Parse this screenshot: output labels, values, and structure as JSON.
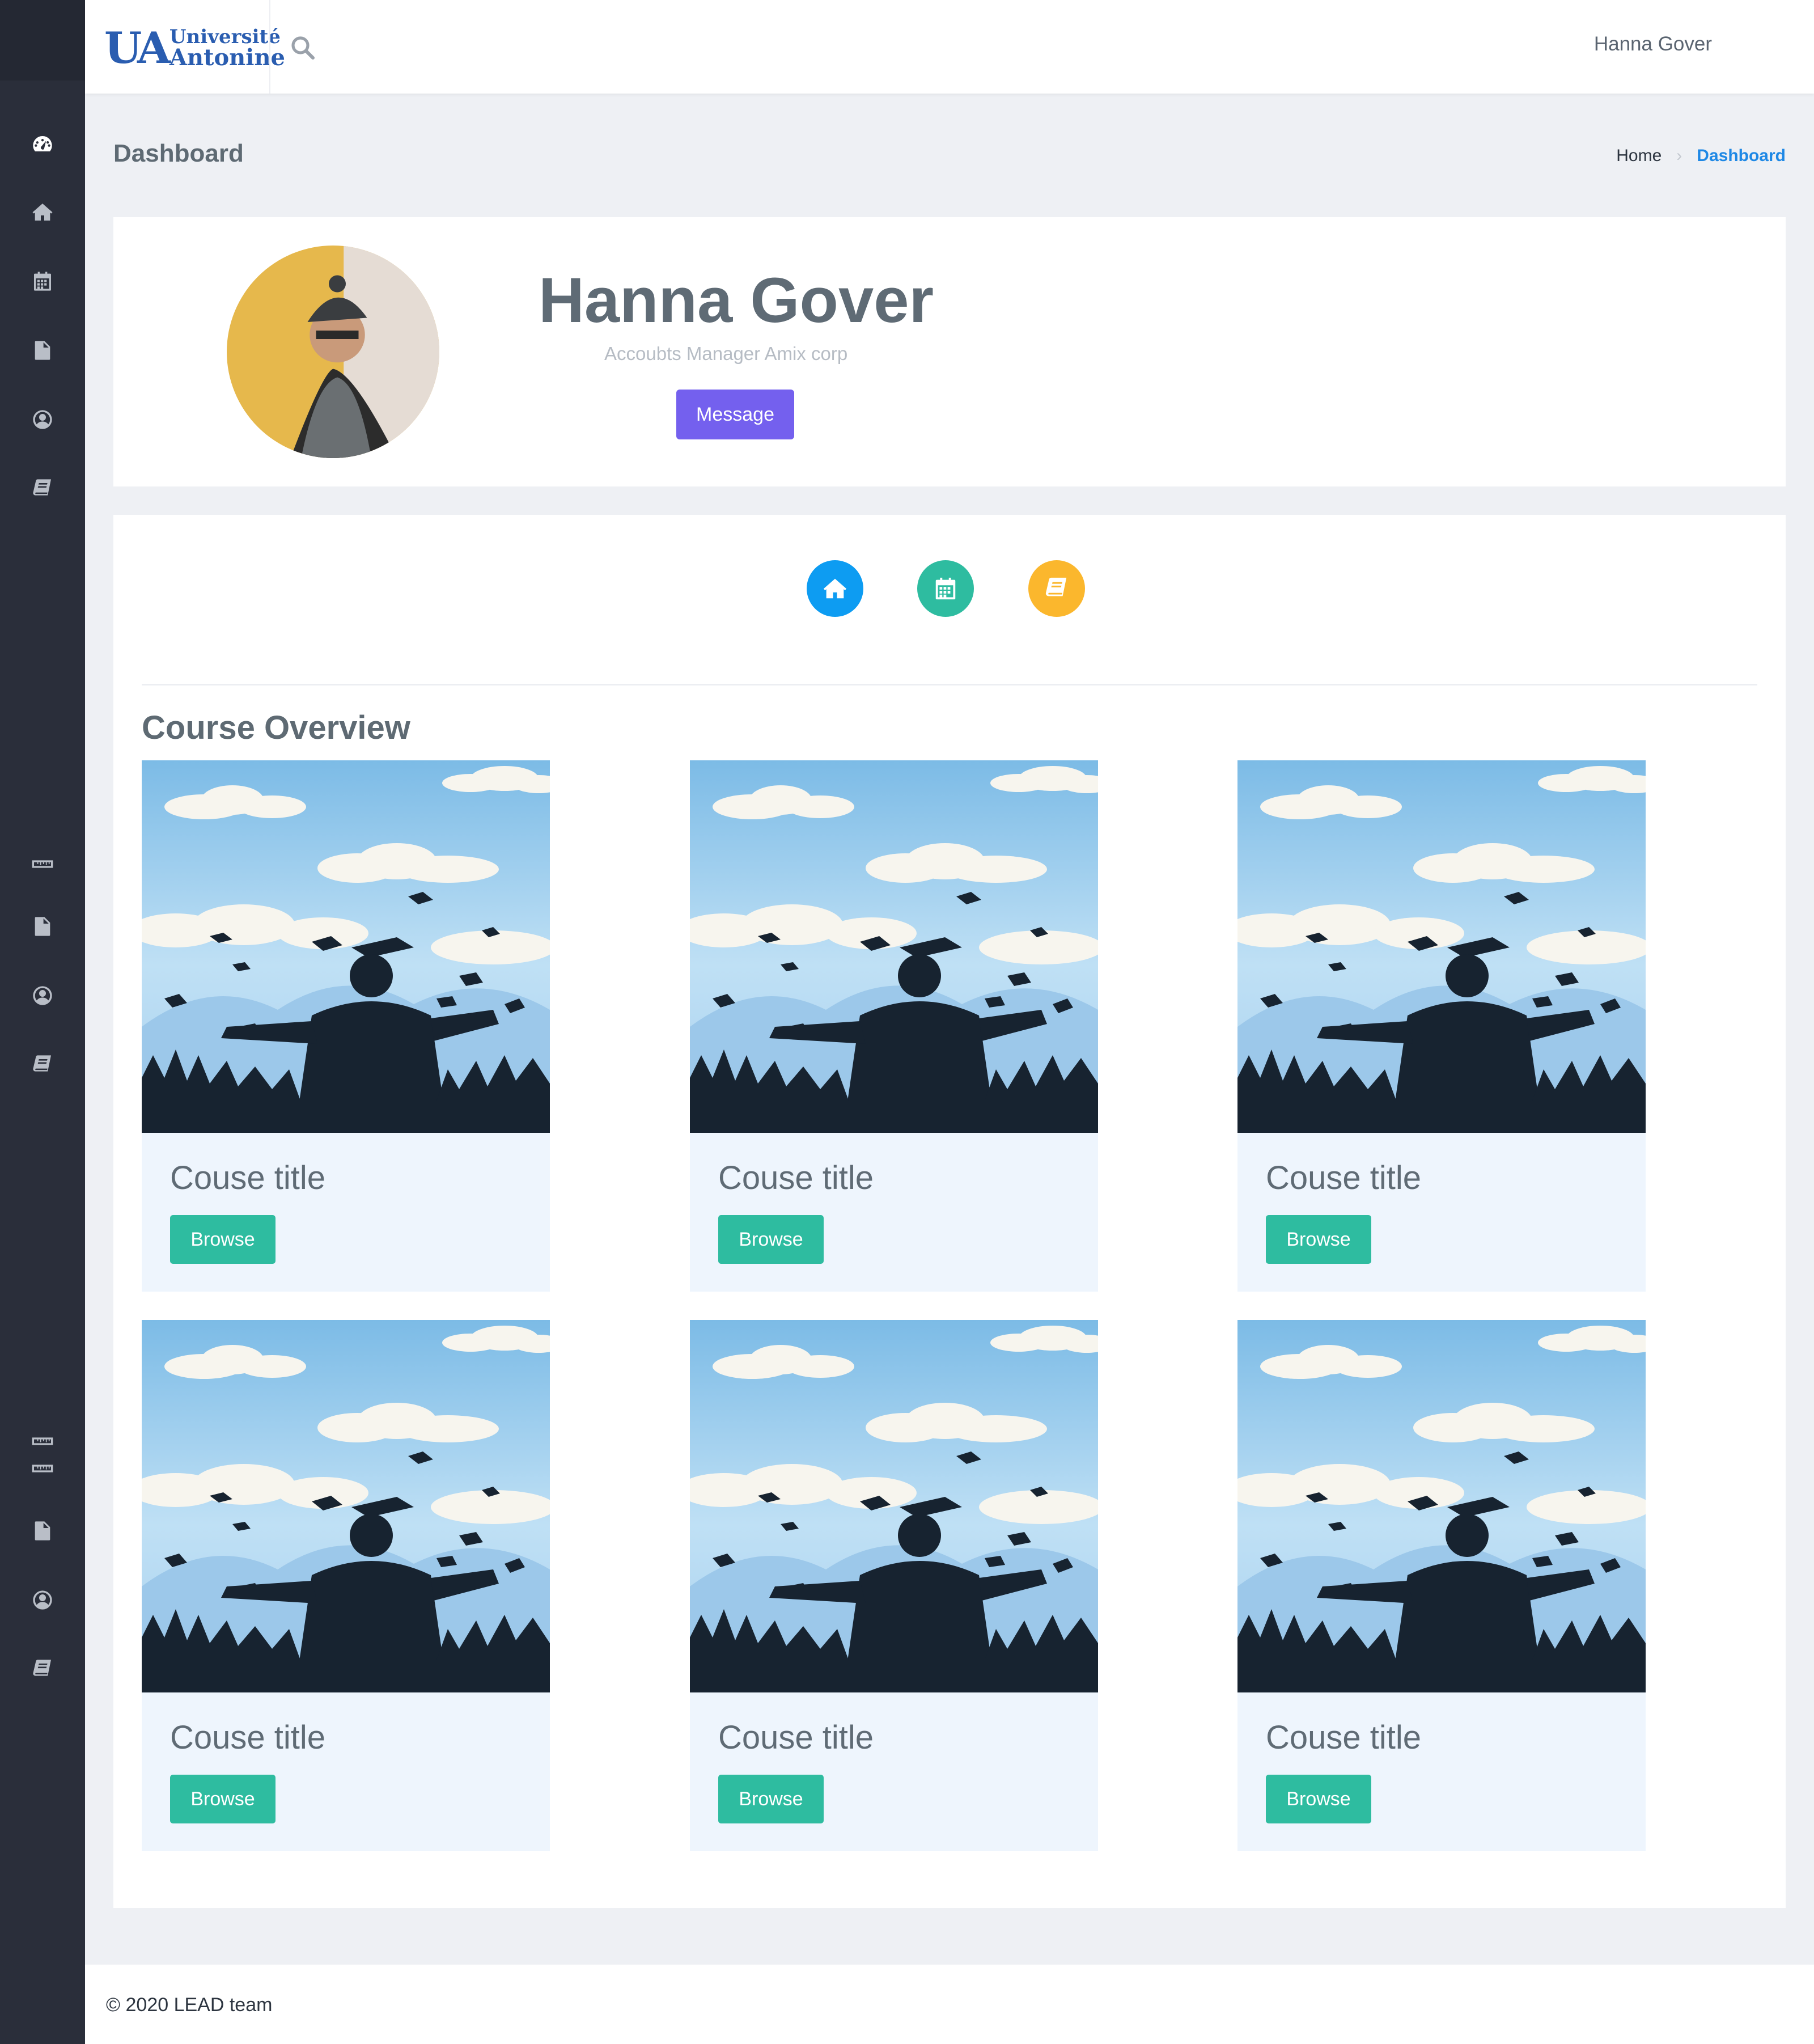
{
  "brand": {
    "logo_line1": "Université",
    "logo_line2": "Antonine",
    "logo_mark": "UA"
  },
  "header": {
    "username": "Hanna Gover"
  },
  "sidebar": {
    "icons": [
      "dashboard-icon",
      "home-icon",
      "calendar-icon",
      "file-icon",
      "user-circle-icon",
      "book-icon",
      "ruler-icon",
      "file-icon",
      "user-circle-icon",
      "book-icon",
      "ruler-icon",
      "ruler-icon",
      "file-icon",
      "user-circle-icon",
      "book-icon"
    ]
  },
  "page": {
    "title": "Dashboard"
  },
  "breadcrumb": {
    "home": "Home",
    "current": "Dashboard"
  },
  "profile": {
    "name": "Hanna Gover",
    "role": "Accoubts Manager Amix corp",
    "message_label": "Message"
  },
  "quick_actions": [
    {
      "icon": "home-icon",
      "color": "#0d9cf2"
    },
    {
      "icon": "calendar-icon",
      "color": "#2ebca0"
    },
    {
      "icon": "book-icon",
      "color": "#fbb72d"
    }
  ],
  "courses": {
    "section_title": "Course Overview",
    "items": [
      {
        "title": "Couse title",
        "button": "Browse"
      },
      {
        "title": "Couse title",
        "button": "Browse"
      },
      {
        "title": "Couse title",
        "button": "Browse"
      },
      {
        "title": "Couse title",
        "button": "Browse"
      },
      {
        "title": "Couse title",
        "button": "Browse"
      },
      {
        "title": "Couse title",
        "button": "Browse"
      }
    ]
  },
  "footer": {
    "text": "© 2020 LEAD team"
  },
  "colors": {
    "sidebar_bg": "#2a2e3a",
    "accent_blue": "#1e88e5",
    "message_button": "#7460ee",
    "browse_button": "#2ebca0"
  }
}
